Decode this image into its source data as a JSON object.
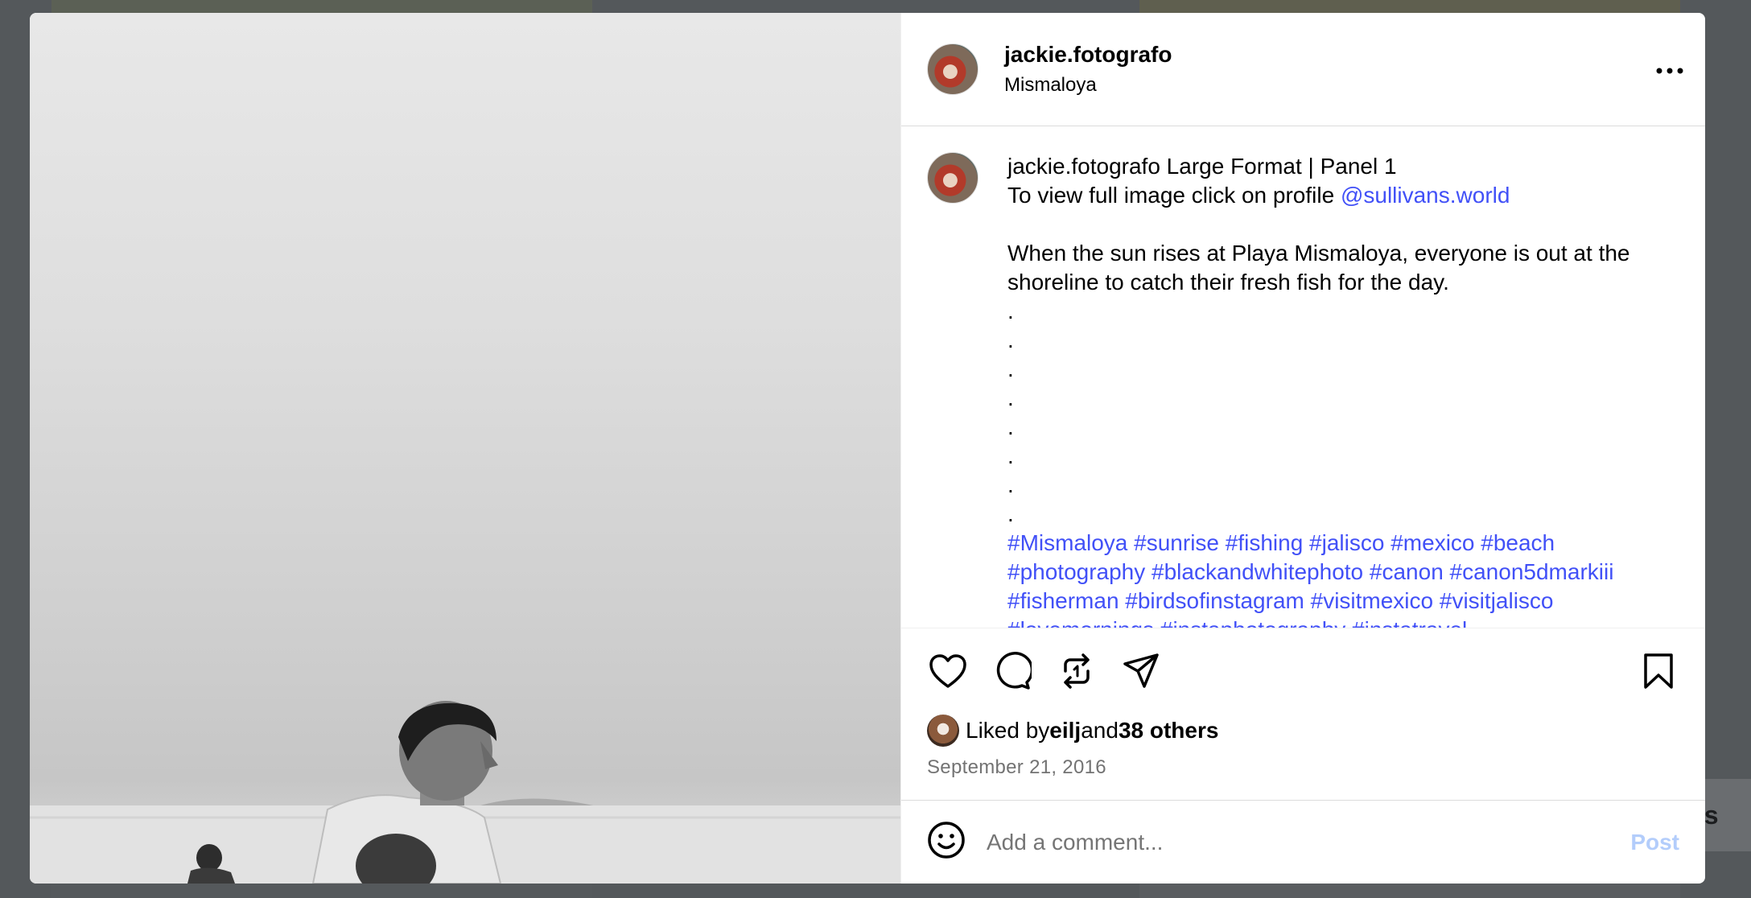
{
  "background": {
    "chip_text": "es"
  },
  "post": {
    "username": "jackie.fotografo",
    "location": "Mismaloya",
    "caption": {
      "username": "jackie.fotografo",
      "line1": " Large Format | Panel 1",
      "line2_prefix": "To view full image click on profile ",
      "mention": "@sullivans.world",
      "body": "When the sun rises at Playa Mismaloya, everyone is out at the shoreline to catch their fresh fish for the day.",
      "dots": [
        ".",
        ".",
        ".",
        ".",
        ".",
        ".",
        ".",
        "."
      ],
      "hashtags_line1": "#Mismaloya #sunrise #fishing #jalisco #mexico #beach",
      "hashtags_line2": "#photography #blackandwhitephoto #canon #canon5dmarkiii",
      "hashtags_line3": "#fisherman #birdsofinstagram #visitmexico #visitjalisco",
      "hashtags_line4": "#lovemornings #instaphotography #instatravel"
    },
    "likes": {
      "prefix": "Liked by ",
      "user": "eilj",
      "and": " and ",
      "others": "38 others"
    },
    "date": "September 21, 2016",
    "comment": {
      "placeholder": "Add a comment...",
      "post_label": "Post"
    }
  },
  "icons": {
    "more": "more-horizontal-icon",
    "like": "heart-icon",
    "comment": "comment-icon",
    "repost": "repost-icon",
    "share": "send-icon",
    "save": "bookmark-icon",
    "emoji": "emoji-icon"
  },
  "colors": {
    "link": "#4150f7",
    "post_disabled": "#b3cdfb",
    "muted": "#737373"
  }
}
